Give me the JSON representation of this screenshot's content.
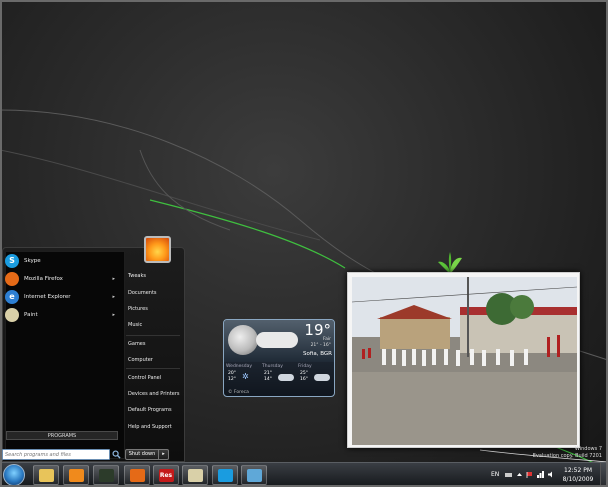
{
  "start_menu": {
    "pinned": [
      {
        "label": "Skype",
        "icon": "skype-icon",
        "color": "#1a9ce0",
        "glyph": "S",
        "submenu": false
      },
      {
        "label": "Mozilla Firefox",
        "icon": "firefox-icon",
        "color": "#e56a17",
        "glyph": "",
        "submenu": true
      },
      {
        "label": "Internet Explorer",
        "icon": "ie-icon",
        "color": "#2d7fd3",
        "glyph": "e",
        "submenu": true
      },
      {
        "label": "Paint",
        "icon": "paint-icon",
        "color": "#d9d0a8",
        "glyph": "",
        "submenu": true
      }
    ],
    "all_programs": "PROGRAMS",
    "search_placeholder": "Search programs and files",
    "right_items": [
      "Tweaks",
      "Documents",
      "Pictures",
      "Music",
      "Games",
      "Computer",
      "Control Panel",
      "Devices and Printers",
      "Default Programs",
      "Help and Support"
    ],
    "shutdown_label": "Shut down",
    "shutdown_arrow": "▸"
  },
  "weather": {
    "current_temp": "19°",
    "condition": "Fair",
    "range": "21° - 16°",
    "city": "Sofia, BGR",
    "forecast": [
      {
        "day": "Wednesday",
        "high": "20°",
        "low": "12°"
      },
      {
        "day": "Thursday",
        "high": "21°",
        "low": "14°"
      },
      {
        "day": "Friday",
        "high": "25°",
        "low": "16°"
      }
    ],
    "source": "© Foreca"
  },
  "watermark": {
    "line1": "Windows 7",
    "line2": "Evaluation copy. Build 7201"
  },
  "taskbar": {
    "apps": [
      {
        "name": "explorer",
        "icon": "folder-icon",
        "color": "#e8c45a"
      },
      {
        "name": "media-player",
        "icon": "media-player-icon",
        "color": "#f08a1c"
      },
      {
        "name": "media-center",
        "icon": "media-center-icon",
        "color": "#2c3b2a"
      },
      {
        "name": "firefox",
        "icon": "firefox-icon",
        "color": "#e56a17"
      },
      {
        "name": "res",
        "icon": "res-icon",
        "color": "#c41a1a",
        "text": "Res"
      },
      {
        "name": "paint",
        "icon": "paint-icon",
        "color": "#d9d0a8"
      },
      {
        "name": "skype",
        "icon": "skype-icon",
        "color": "#1a9ce0"
      },
      {
        "name": "notepad",
        "icon": "notepad-icon",
        "color": "#5fa8d8"
      }
    ],
    "language": "EN",
    "time": "12:52 PM",
    "date": "8/10/2009"
  }
}
